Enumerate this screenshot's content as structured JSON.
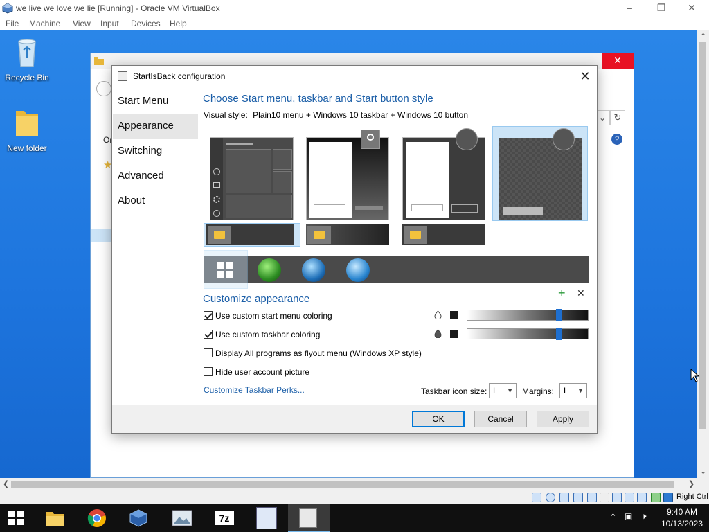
{
  "host": {
    "title": "we live we love we lie [Running] - Oracle VM VirtualBox",
    "menu": [
      "File",
      "Machine",
      "View",
      "Input",
      "Devices",
      "Help"
    ],
    "status_right": "Right Ctrl"
  },
  "desktop": {
    "icons": [
      {
        "label": "Recycle Bin",
        "icon": "recycle-bin-icon"
      },
      {
        "label": "New folder",
        "icon": "folder-icon"
      }
    ]
  },
  "explorer_fragments": {
    "partial_text": "Or"
  },
  "dialog": {
    "title": "StartIsBack configuration",
    "nav": [
      "Start Menu",
      "Appearance",
      "Switching",
      "Advanced",
      "About"
    ],
    "active_nav": "Appearance",
    "heading_style": "Choose Start menu, taskbar and Start button style",
    "visual_style_label": "Visual style:",
    "visual_style_value": "Plain10 menu + Windows 10 taskbar + Windows 10 button",
    "heading_customize": "Customize appearance",
    "options": [
      {
        "label": "Use custom start menu coloring",
        "checked": true
      },
      {
        "label": "Use custom taskbar coloring",
        "checked": true
      },
      {
        "label": "Display All programs as flyout menu (Windows XP style)",
        "checked": false
      },
      {
        "label": "Hide user account picture",
        "checked": false
      }
    ],
    "start_menu_slider_level": 0.75,
    "taskbar_slider_level": 0.75,
    "customize_link": "Customize Taskbar Perks...",
    "taskbar_icon_size_label": "Taskbar icon size:",
    "taskbar_icon_size_value": "L",
    "margins_label": "Margins:",
    "margins_value": "L",
    "buttons": {
      "ok": "OK",
      "cancel": "Cancel",
      "apply": "Apply"
    },
    "add_symbol": "+",
    "remove_symbol": "✕",
    "colors": {
      "accent": "#1c5fa8",
      "selection": "#cce4f7",
      "slider_knob": "#1e6fd0"
    }
  },
  "taskbar": {
    "apps": [
      "start-icon",
      "file-explorer-icon",
      "chrome-icon",
      "virtualbox-icon",
      "photos-icon",
      "7zip-icon",
      "app-64-icon",
      "startisback-config-icon"
    ],
    "time": "9:40 AM",
    "date": "10/13/2023"
  }
}
